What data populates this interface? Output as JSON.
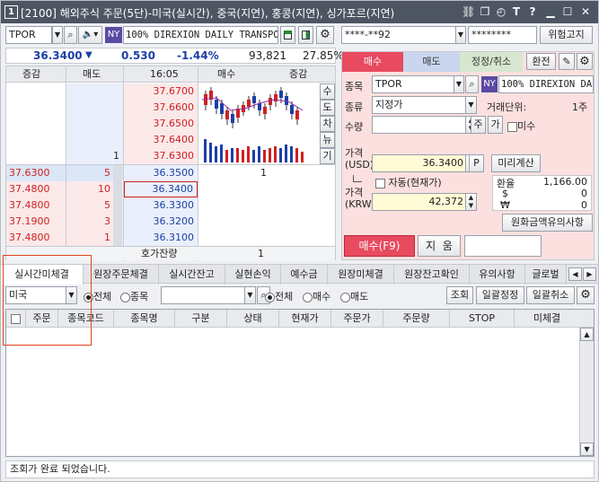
{
  "window": {
    "number": "1",
    "title": "[2100] 해외주식 주문(5단)-미국(실시간), 중국(지연), 홍콩(지연), 싱가포르(지연)",
    "buttons": [
      "T",
      "?",
      ""
    ]
  },
  "quote": {
    "symbol": "TPOR",
    "market_badge": "NY",
    "pct_badge": "100%",
    "name": "DIREXION DAILY TRANSPORT",
    "price": "36.3400",
    "change": "0.530",
    "change_pct": "-1.44%",
    "volume": "93,821",
    "rate": "27.85%"
  },
  "orderbook": {
    "headers": {
      "left_change": "증감",
      "sell": "매도",
      "time": "16:05",
      "buy": "매수",
      "right_change": "증감"
    },
    "ask_prices": [
      "37.6700",
      "37.6600",
      "37.6500",
      "37.6400",
      "37.6300"
    ],
    "ask_volumes": [
      "",
      "",
      "",
      "",
      "1"
    ],
    "bid_left_prices": [
      "37.6300",
      "37.4800",
      "37.4800",
      "37.1900",
      "37.4800"
    ],
    "bid_left_volumes": [
      "5",
      "10",
      "5",
      "3",
      "1"
    ],
    "bid_prices": [
      "36.3500",
      "36.3400",
      "36.3300",
      "36.3200",
      "36.3100"
    ],
    "bid_volumes": [
      "1",
      "",
      "",
      "",
      ""
    ],
    "footer_label": "호가잔량",
    "footer_value": "1",
    "side_buttons": [
      "수",
      "도",
      "차",
      "뉴",
      "기"
    ]
  },
  "account": {
    "number": "****-**92",
    "password": "********",
    "notice_button": "위험고지"
  },
  "order": {
    "tabs": [
      "매수",
      "매도",
      "정정/취소"
    ],
    "confirm_button": "환전",
    "symbol_label": "종목",
    "symbol": "TPOR",
    "name": "DIREXION DAI",
    "type_label": "종류",
    "type_value": "지정가",
    "unit_label": "거래단위:",
    "unit_value": "1주",
    "qty_label": "수량",
    "qty_btn_main": "주",
    "qty_btn_ga": "가",
    "odd_lot_label": "미수",
    "price_usd_label": "가격\n(USD)",
    "price_usd": "36.3400",
    "p_button": "P",
    "preview_button": "미리계산",
    "auto_label": "자동(현재가)",
    "price_krw_label": "가격\n(KRW)",
    "price_krw": "42,372",
    "fx_label": "환율",
    "fx_value": "1,166.00",
    "usd_sym": "$",
    "usd_value": "0",
    "krw_sym": "₩",
    "krw_value": "0",
    "krw_notice_button": "원화금액유의사항",
    "submit_button": "매수(F9)",
    "clear_button": "지  움"
  },
  "lower": {
    "tabs": [
      "실시간미체결",
      "원장주문체결",
      "실시간잔고",
      "실현손익",
      "예수금",
      "원장미체결",
      "원장잔고확인",
      "유의사항",
      "글로벌"
    ],
    "market_select": "미국",
    "radio_all": "전체",
    "radio_symbol": "종목",
    "radio2_all": "전체",
    "radio2_buy": "매수",
    "radio2_sell": "매도",
    "btn_query": "조회",
    "btn_bulk_modify": "일괄정정",
    "btn_bulk_cancel": "일괄취소",
    "columns": [
      "주문",
      "종목코드",
      "종목명",
      "구분",
      "상태",
      "현재가",
      "주문가",
      "주문량",
      "STOP",
      "미체결"
    ]
  },
  "status": {
    "message": "조회가 완료 되었습니다."
  }
}
